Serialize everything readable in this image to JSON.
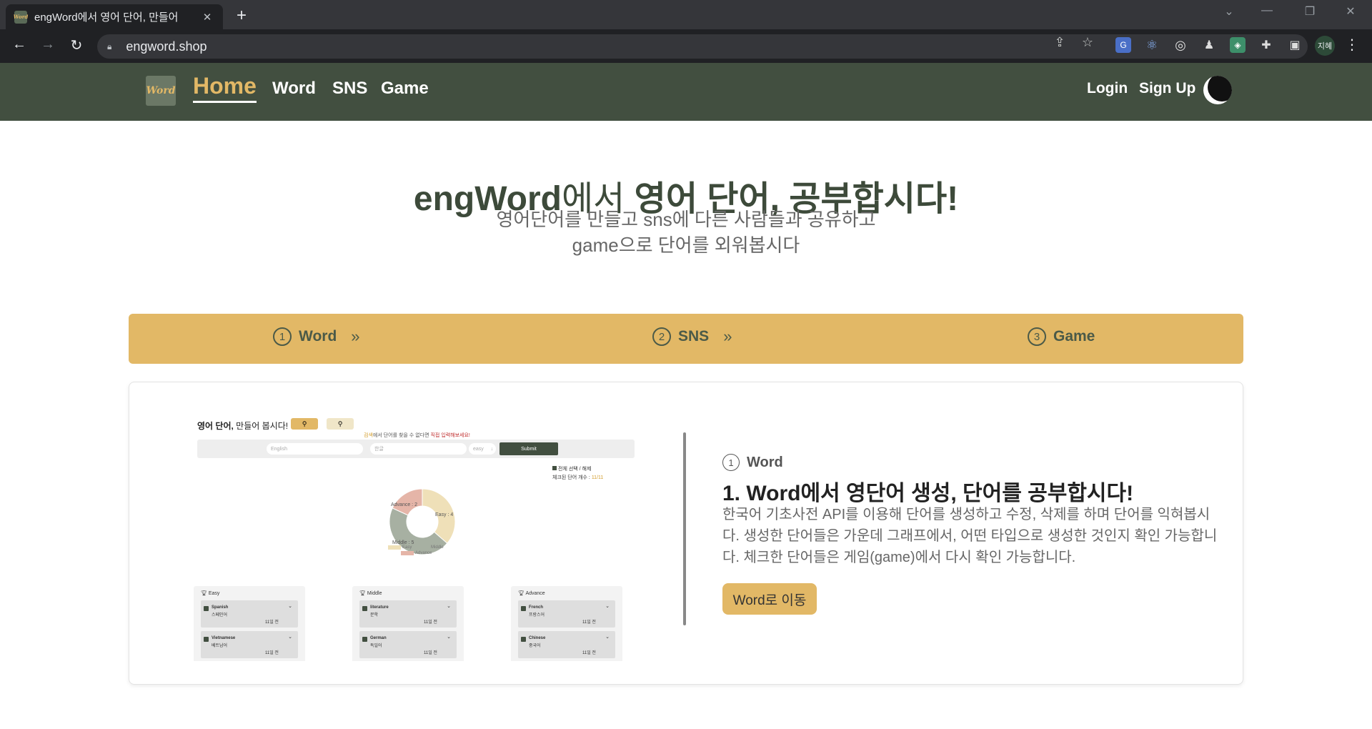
{
  "browser": {
    "tab_title": "engWord에서 영어 단어, 만들어",
    "tab_favicon_text": "Word",
    "tab_close": "✕",
    "new_tab": "+",
    "url": "engword.shop",
    "profile_label": "지혜"
  },
  "nav": {
    "logo": "Word",
    "links": [
      "Home",
      "Word",
      "SNS",
      "Game"
    ],
    "login": "Login",
    "signup": "Sign Up"
  },
  "hero": {
    "title_brand": "engWord",
    "title_light": "에서 ",
    "title_bold": "영어 단어, 공부합시다!",
    "subtitle_line1": "영어단어를 만들고 sns에 다른 사람들과 공유하고",
    "subtitle_line2": "game으로 단어를 외워봅시다"
  },
  "steps": [
    {
      "num": "1",
      "label": "Word",
      "chevron": "»"
    },
    {
      "num": "2",
      "label": "SNS",
      "chevron": "»"
    },
    {
      "num": "3",
      "label": "Game",
      "chevron": ""
    }
  ],
  "preview": {
    "title_bold": "영어 단어,",
    "title_rest": " 만들어 봅시다!",
    "hint_a": "검색",
    "hint_b": "에서 단어를 찾을 수 없다면 ",
    "hint_c": "직접 입력해보세요!",
    "input_english": "English",
    "input_korean": "한글",
    "select_level": "easy",
    "submit": "Submit",
    "check_all": "전체 선택 / 해제",
    "checked_count_label": "체크된 단어 개수 : ",
    "checked_count": "11/11",
    "chart_labels": {
      "advance": "Advance : 2",
      "easy": "Easy : 4",
      "middle": "Middle : 5"
    },
    "legend": [
      "Easy",
      "Middle",
      "Advance"
    ],
    "columns": [
      {
        "header": "Easy",
        "items": [
          {
            "word": "Spanish",
            "meaning": "스페인어",
            "date": "11일 전"
          },
          {
            "word": "Vietnamese",
            "meaning": "베트남어",
            "date": "11일 전"
          }
        ]
      },
      {
        "header": "Middle",
        "items": [
          {
            "word": "literature",
            "meaning": "문학",
            "date": "11일 전"
          },
          {
            "word": "German",
            "meaning": "독일어",
            "date": "11일 전"
          }
        ]
      },
      {
        "header": "Advance",
        "items": [
          {
            "word": "French",
            "meaning": "프랑스어",
            "date": "11일 전"
          },
          {
            "word": "Chinese",
            "meaning": "중국어",
            "date": "11일 전"
          }
        ]
      }
    ]
  },
  "description": {
    "step_num": "1",
    "step_label": "Word",
    "title": "1. Word에서 영단어 생성, 단어를 공부합시다!",
    "body": "한국어 기초사전 API를 이용해 단어를 생성하고 수정, 삭제를 하며 단어를 익혀봅시다. 생성한 단어들은 가운데 그래프에서, 어떤 타입으로 생성한 것인지 확인 가능합니다. 체크한 단어들은 게임(game)에서 다시 확인 가능합니다.",
    "button": "Word로 이동"
  },
  "colors": {
    "nav_bg": "#424f40",
    "accent": "#e2b866",
    "easy": "#efe0b8",
    "middle": "#a7b0a2",
    "advance": "#e5b5a8"
  },
  "chart_data": {
    "type": "pie",
    "categories": [
      "Easy",
      "Middle",
      "Advance"
    ],
    "values": [
      4,
      5,
      2
    ]
  }
}
